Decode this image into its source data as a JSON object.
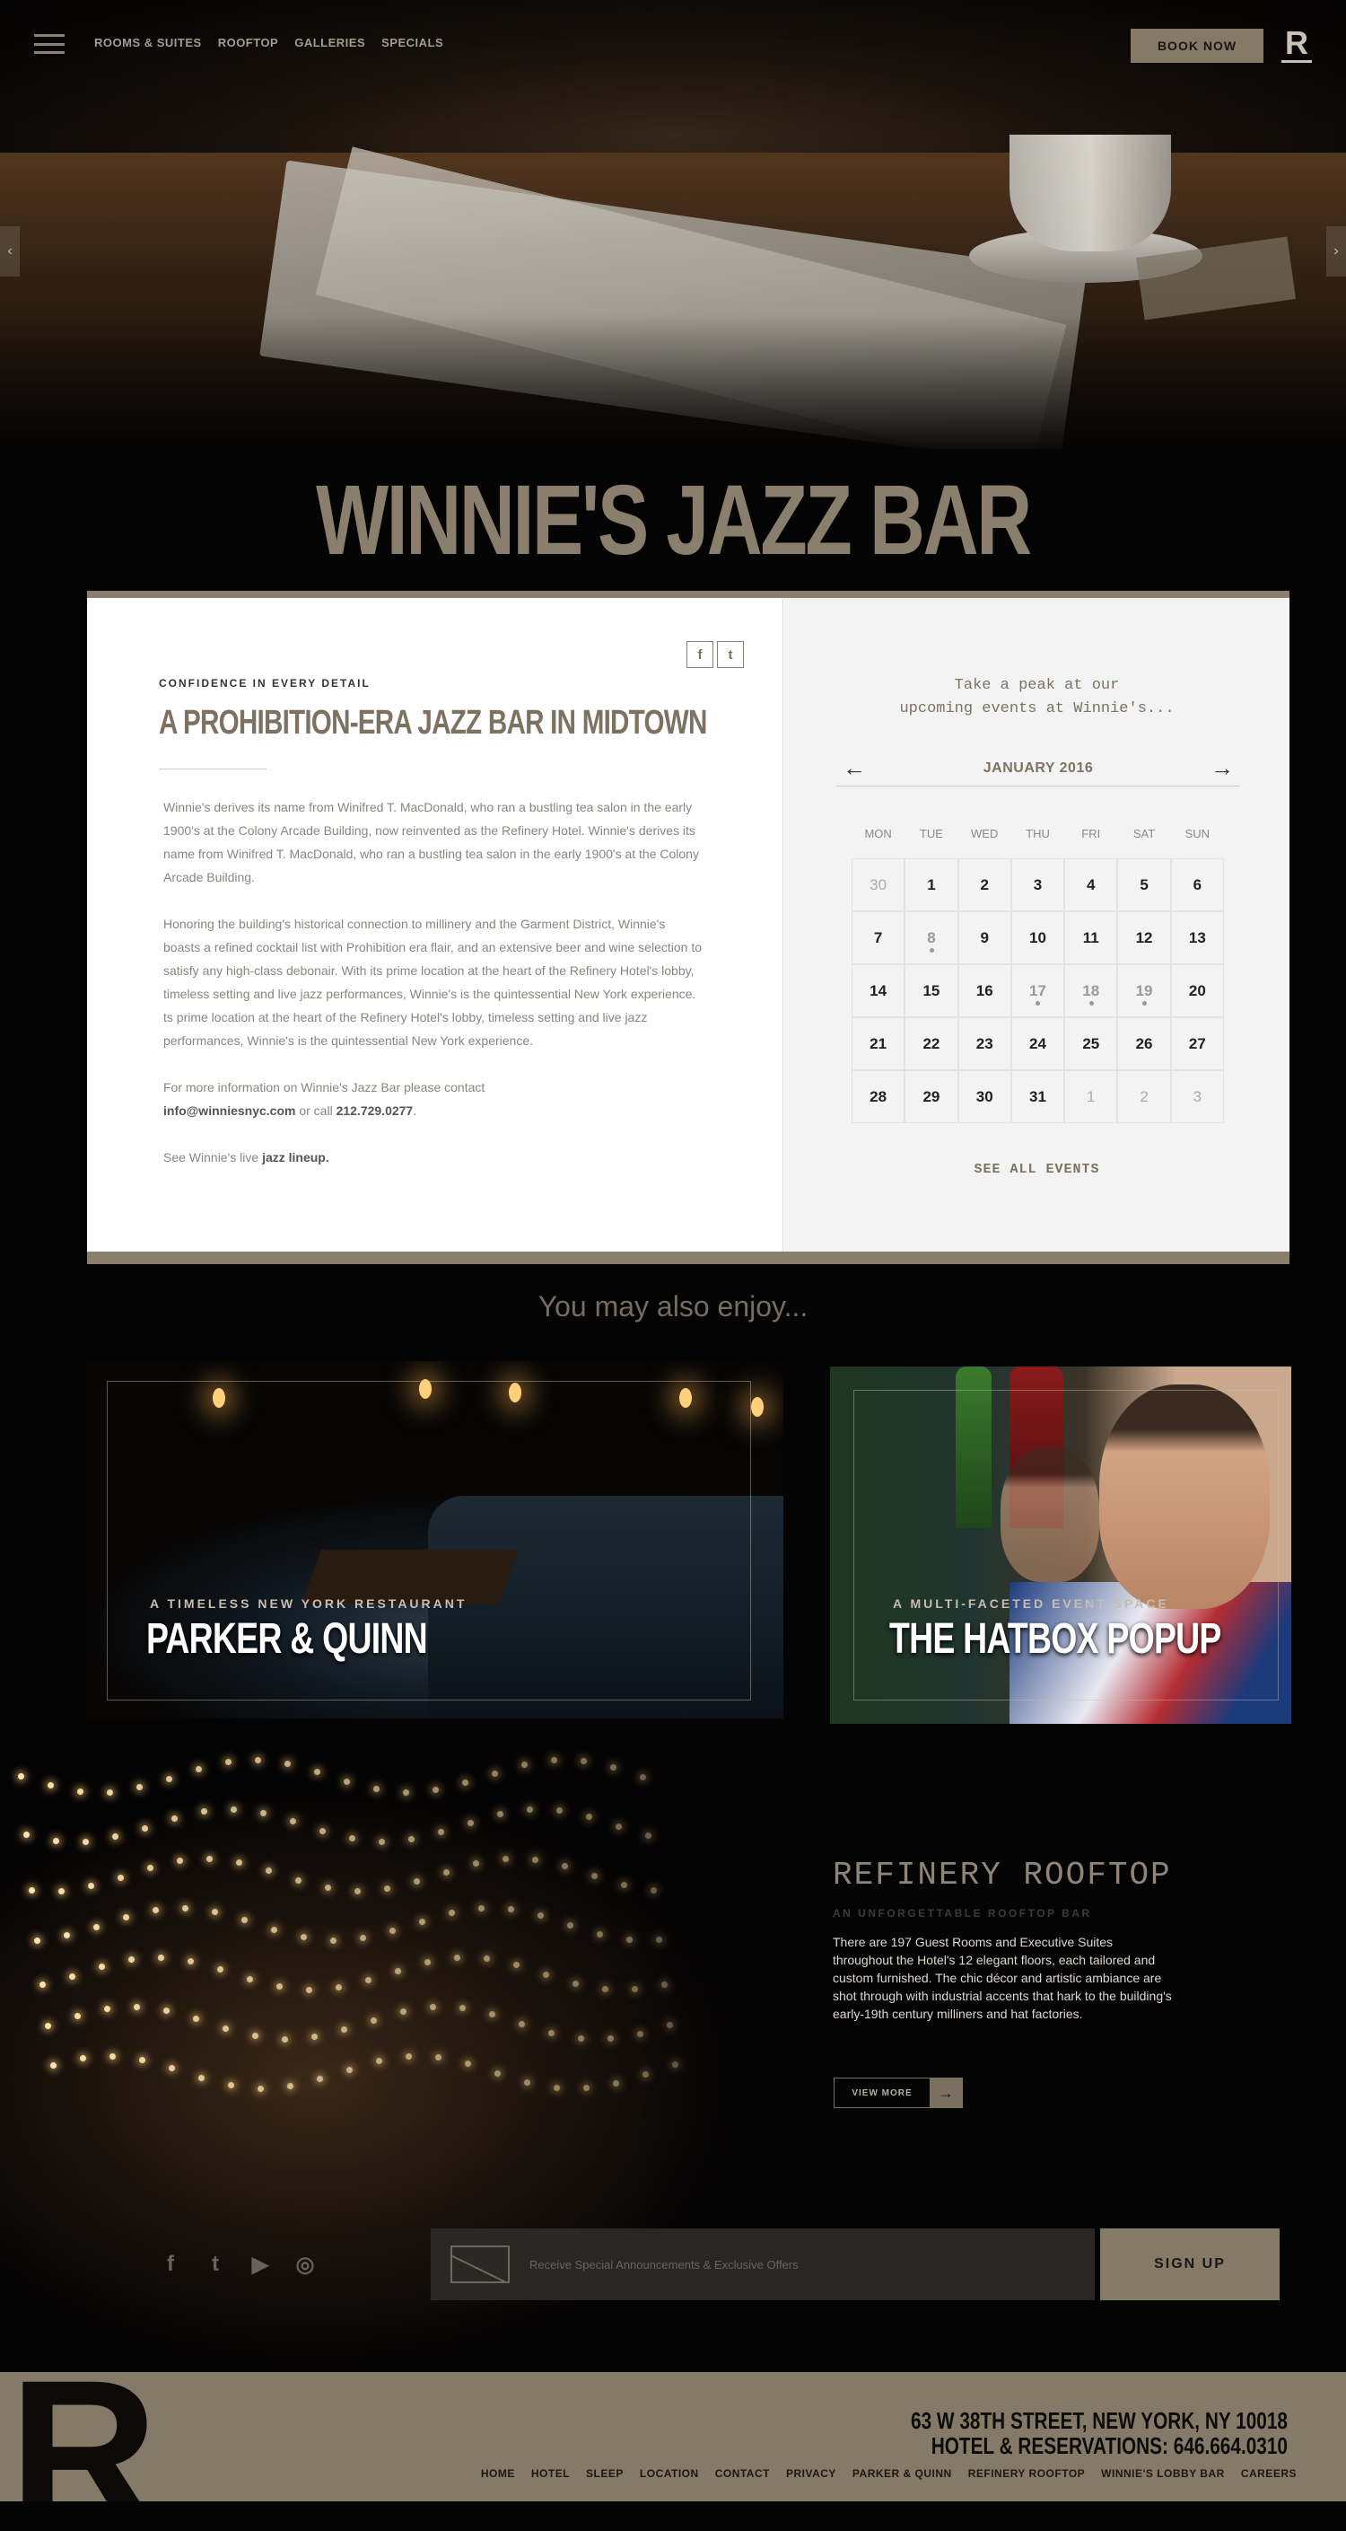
{
  "header": {
    "nav": [
      "ROOMS & SUITES",
      "ROOFTOP",
      "GALLERIES",
      "SPECIALS"
    ],
    "book_now": "BOOK NOW",
    "logo": "R",
    "prev_arrow": "‹",
    "next_arrow": "›"
  },
  "page_title": "WINNIE'S JAZZ BAR",
  "article": {
    "social": {
      "facebook": "f",
      "twitter": "t"
    },
    "eyebrow": "CONFIDENCE IN EVERY DETAIL",
    "heading": "A PROHIBITION-ERA JAZZ BAR IN MIDTOWN",
    "para1": "Winnie's derives its name from Winifred T. MacDonald, who ran a bustling tea salon in the early 1900's at the Colony Arcade Building, now reinvented as the Refinery Hotel. Winnie's derives its name from Winifred T. MacDonald, who ran a bustling tea salon in the early 1900's at the Colony Arcade Building.",
    "para2": "Honoring the building's historical connection to millinery and the Garment District, Winnie's boasts a refined cocktail list with Prohibition era flair, and an extensive beer and wine selection to satisfy any high-class debonair. With its prime location at the heart of the Refinery Hotel's lobby, timeless setting and live jazz performances, Winnie's is the quintessential New York experience. ts prime location at the heart of the Refinery Hotel's lobby, timeless setting and live jazz performances, Winnie's is the quintessential  New York experience.",
    "contact_pre": "For more information on Winnie's Jazz Bar please contact",
    "email": "info@winniesnyc.com",
    "or_call": " or call ",
    "phone": "212.729.0277",
    "period": ".",
    "lineup_pre": "See Winnie's live ",
    "lineup_link": "jazz lineup."
  },
  "calendar": {
    "intro_line1": "Take a peak at our",
    "intro_line2": "upcoming events at Winnie's...",
    "prev": "←",
    "next": "→",
    "month": "JANUARY 2016",
    "weekdays": [
      "MON",
      "TUE",
      "WED",
      "THU",
      "FRI",
      "SAT",
      "SUN"
    ],
    "days": [
      {
        "d": "30",
        "state": "out"
      },
      {
        "d": "1"
      },
      {
        "d": "2"
      },
      {
        "d": "3"
      },
      {
        "d": "4"
      },
      {
        "d": "5"
      },
      {
        "d": "6"
      },
      {
        "d": "7"
      },
      {
        "d": "8",
        "state": "event"
      },
      {
        "d": "9"
      },
      {
        "d": "10"
      },
      {
        "d": "11"
      },
      {
        "d": "12"
      },
      {
        "d": "13"
      },
      {
        "d": "14"
      },
      {
        "d": "15"
      },
      {
        "d": "16"
      },
      {
        "d": "17",
        "state": "event"
      },
      {
        "d": "18",
        "state": "event"
      },
      {
        "d": "19",
        "state": "event"
      },
      {
        "d": "20"
      },
      {
        "d": "21"
      },
      {
        "d": "22"
      },
      {
        "d": "23"
      },
      {
        "d": "24"
      },
      {
        "d": "25"
      },
      {
        "d": "26"
      },
      {
        "d": "27"
      },
      {
        "d": "28"
      },
      {
        "d": "29"
      },
      {
        "d": "30"
      },
      {
        "d": "31"
      },
      {
        "d": "1",
        "state": "out"
      },
      {
        "d": "2",
        "state": "out"
      },
      {
        "d": "3",
        "state": "out"
      }
    ],
    "see_all": "SEE ALL EVENTS"
  },
  "enjoy": {
    "heading": "You may also enjoy...",
    "cards": [
      {
        "sub": "A TIMELESS NEW YORK RESTAURANT",
        "title": "PARKER & QUINN"
      },
      {
        "sub": "A MULTI-FACETED EVENT SPACE",
        "title": "THE HATBOX POPUP"
      }
    ]
  },
  "rooftop": {
    "title": "REFINERY ROOFTOP",
    "subtitle": "AN UNFORGETTABLE ROOFTOP BAR",
    "body": "There are 197 Guest Rooms and Executive Suites throughout the Hotel's 12 elegant floors, each tailored and custom furnished. The chic décor and artistic ambiance are shot through with industrial accents that hark to the building's early-19th century milliners and hat factories.",
    "view_more": "VIEW MORE",
    "arrow": "→"
  },
  "signup": {
    "socials": [
      "f",
      "t",
      "▶",
      "◎"
    ],
    "placeholder": "Receive Special Announcements & Exclusive Offers",
    "button": "SIGN UP"
  },
  "footer": {
    "logo": "R",
    "address": "63 W 38TH STREET, NEW YORK, NY 10018",
    "reservations": "HOTEL & RESERVATIONS: 646.664.0310",
    "nav": [
      "HOME",
      "HOTEL",
      "SLEEP",
      "LOCATION",
      "CONTACT",
      "PRIVACY",
      "PARKER & QUINN",
      "REFINERY ROOFTOP",
      "WINNIE'S LOBBY BAR",
      "CAREERS"
    ]
  },
  "colors": {
    "accent": "#857a68",
    "title": "#8a7f6d",
    "dark": "#050404"
  }
}
